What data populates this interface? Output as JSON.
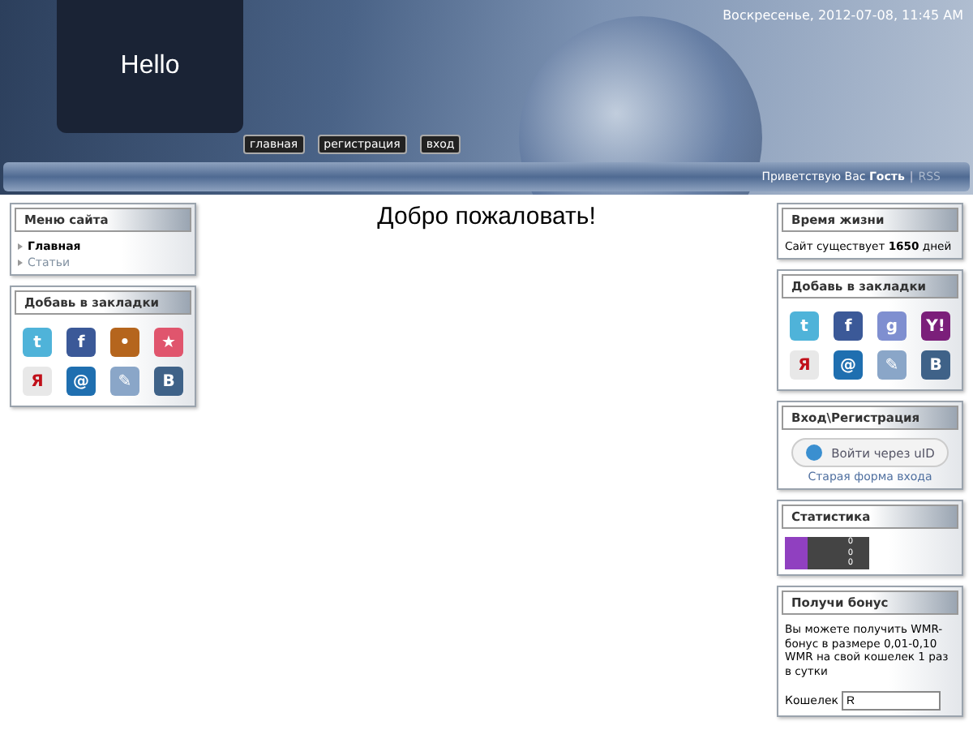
{
  "header": {
    "site_title": "Hello",
    "date": "Воскресенье, 2012-07-08, 11:45 AM",
    "nav": [
      {
        "label": "главная"
      },
      {
        "label": "регистрация"
      },
      {
        "label": "вход"
      }
    ],
    "greeting": "Приветствую Вас **Гость**",
    "separator": "|",
    "rss": "RSS"
  },
  "left": [
    {
      "kind": "menu",
      "title": "Меню сайта",
      "items": [
        {
          "label": "Главная",
          "selected": true
        },
        {
          "label": "Статьи",
          "selected": false
        }
      ]
    },
    {
      "kind": "bookmarks",
      "title": "Добавь в закладки",
      "items": [
        {
          "glyph": "t",
          "color": "#4fb3d9"
        },
        {
          "glyph": "f",
          "color": "#3b5998"
        },
        {
          "glyph": "•",
          "color": "#b5651d"
        },
        {
          "glyph": "★",
          "color": "#e0556d"
        },
        {
          "glyph": "Я",
          "color": "#e8e8e8"
        },
        {
          "glyph": "@",
          "color": "#1f6fb0"
        },
        {
          "glyph": "✎",
          "color": "#8aa6c8"
        },
        {
          "glyph": "B",
          "color": "#3f6288"
        }
      ]
    }
  ],
  "main": {
    "heading": "Добро пожаловать!"
  },
  "right": [
    {
      "kind": "text",
      "title": "Время жизни",
      "text": "Сайт существует **1650** дней"
    },
    {
      "kind": "bookmarks",
      "title": "Добавь в закладки",
      "items": [
        {
          "glyph": "t",
          "color": "#4fb3d9"
        },
        {
          "glyph": "f",
          "color": "#3b5998"
        },
        {
          "glyph": "g",
          "color": "#7f8fd0"
        },
        {
          "glyph": "Y!",
          "color": "#7b1f7a"
        },
        {
          "glyph": "Я",
          "color": "#e8e8e8"
        },
        {
          "glyph": "@",
          "color": "#1f6fb0"
        },
        {
          "glyph": "✎",
          "color": "#8aa6c8"
        },
        {
          "glyph": "B",
          "color": "#3f6288"
        }
      ]
    },
    {
      "kind": "login",
      "title": "Вход\\Регистрация",
      "button": "Войти через uID",
      "link": "Старая форма входа"
    },
    {
      "kind": "stats",
      "title": "Статистика",
      "values": [
        "0",
        "0",
        "0"
      ]
    },
    {
      "kind": "bonus",
      "title": "Получи бонус",
      "text": "Вы можете получить WMR-бонус в размере 0,01-0,10 WMR на свой кошелек 1 раз в сутки",
      "field_label": "Кошелек",
      "field_value": "R"
    }
  ]
}
